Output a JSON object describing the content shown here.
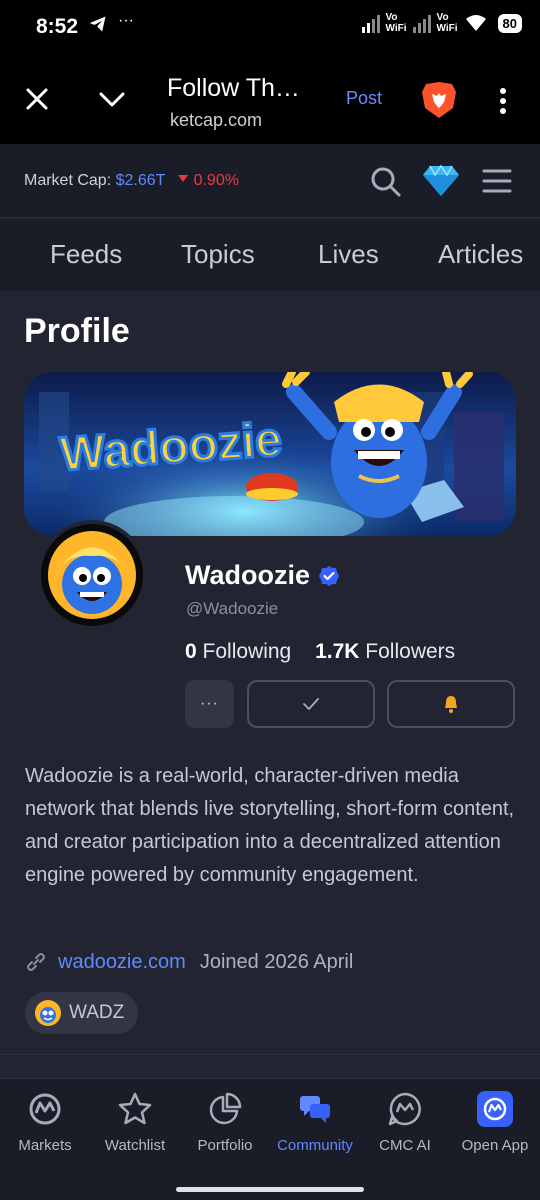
{
  "status_bar": {
    "time": "8:52",
    "left_icons": [
      "telegram-icon",
      "more-dots"
    ],
    "more_text": "···",
    "sim1": "Vo\nWiFi",
    "sim2": "Vo\nWiFi",
    "battery": "80"
  },
  "browser": {
    "title": "Follow Th…",
    "url": "ketcap.com",
    "post_label": "Post",
    "icons": [
      "close-icon",
      "chevron-down-icon",
      "brave-lion-icon",
      "kebab-menu-icon"
    ]
  },
  "market": {
    "label": "Market Cap:",
    "value": "$2.66T",
    "change": "0.90%",
    "change_color": "#ea3943",
    "accent_color": "#6188ff"
  },
  "tabs": [
    "Feeds",
    "Topics",
    "Lives",
    "Articles"
  ],
  "profile": {
    "heading": "Profile",
    "banner_text": "Wadoozie",
    "name": "Wadoozie",
    "handle": "@Wadoozie",
    "following_count": "0",
    "following_label": "Following",
    "followers_count": "1.7K",
    "followers_label": "Followers",
    "more_button": "···",
    "bio": "Wadoozie is a real-world, character-driven media network that blends live storytelling, short-form content, and creator participation into a decentralized attention engine powered by community engagement.",
    "website": "wadoozie.com",
    "joined": "Joined 2026 April",
    "token": "WADZ"
  },
  "bottom_nav": [
    {
      "label": "Markets",
      "icon": "cmc-logo-icon",
      "active": false
    },
    {
      "label": "Watchlist",
      "icon": "star-icon",
      "active": false
    },
    {
      "label": "Portfolio",
      "icon": "pie-chart-icon",
      "active": false
    },
    {
      "label": "Community",
      "icon": "chat-bubbles-icon",
      "active": true
    },
    {
      "label": "CMC AI",
      "icon": "cmc-ai-icon",
      "active": false
    },
    {
      "label": "Open App",
      "icon": "cmc-app-icon",
      "active": false
    }
  ]
}
